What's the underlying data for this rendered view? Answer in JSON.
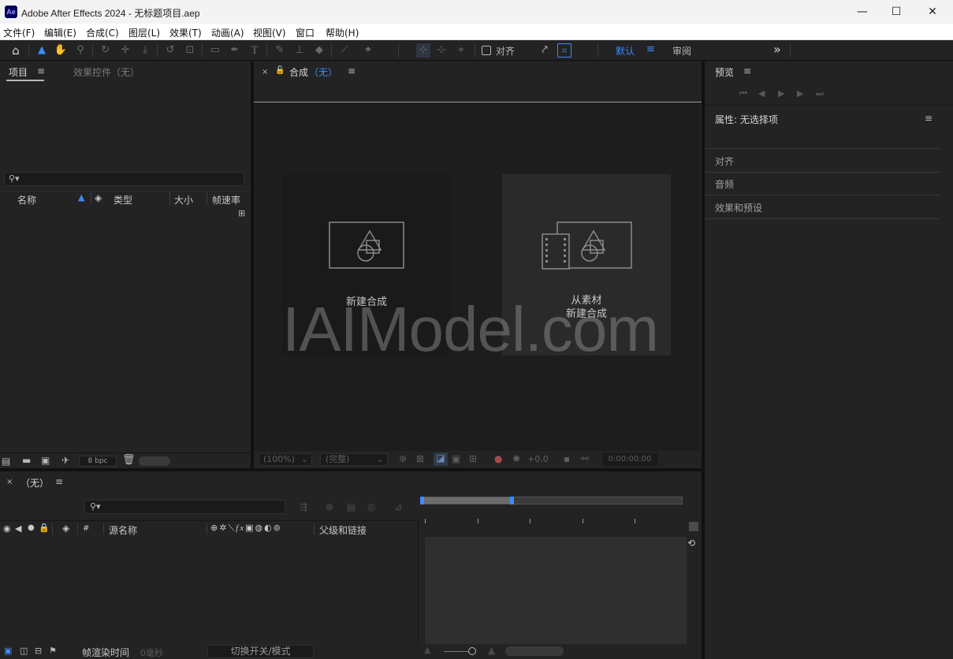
{
  "window": {
    "app_icon": "Ae",
    "title": "Adobe After Effects 2024 - 无标题项目.aep",
    "min_icon": "—",
    "max_icon": "☐",
    "close_icon": "✕"
  },
  "menu": [
    "文件(F)",
    "编辑(E)",
    "合成(C)",
    "图层(L)",
    "效果(T)",
    "动画(A)",
    "视图(V)",
    "窗口",
    "帮助(H)"
  ],
  "toolbar": {
    "align_label": "对齐",
    "workspace_default": "默认",
    "workspace_review": "审阅",
    "more": "»"
  },
  "project_panel": {
    "tab_project": "项目",
    "tab_effects": "效果控件（无）",
    "columns": [
      "名称",
      "类型",
      "大小",
      "帧速率"
    ],
    "bpc": "8 bpc"
  },
  "comp_panel": {
    "tab_label": "合成",
    "tab_comp_name": "（无）",
    "new_comp": "新建合成",
    "from_footage_line1": "从素材",
    "from_footage_line2": "新建合成",
    "zoom": "(100%)",
    "quality": "(完整)",
    "exposure": "+0.0",
    "timecode": "0:00:00:00"
  },
  "watermark": "IAIModel.com",
  "right_panel": {
    "preview": "预览",
    "properties": "属性: 无选择项",
    "sections": [
      "对齐",
      "音频",
      "效果和预设"
    ]
  },
  "timeline": {
    "tab_name": "（无）",
    "col_hash": "#",
    "col_source": "源名称",
    "col_parent": "父级和链接",
    "render_time_label": "帧渲染时间",
    "render_time_value": "0毫秒",
    "toggle_modes": "切换开关/模式"
  },
  "colors": {
    "accent": "#3d8bfd",
    "panel": "#232323",
    "background": "#1d1d1d"
  }
}
